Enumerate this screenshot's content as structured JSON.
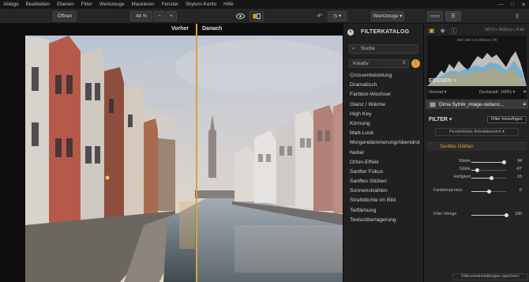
{
  "menu": [
    "Ablage",
    "Bearbeiten",
    "Ebenen",
    "Filter",
    "Werkzeuge",
    "Maskieren",
    "Fenster",
    "Skylum-Konto",
    "Hilfe"
  ],
  "toolbar": {
    "open_label": "Öffnen",
    "zoom_value": "44 %",
    "zoom_out": "−",
    "zoom_in": "+",
    "tools_label": "Werkzeuge"
  },
  "canvas": {
    "before_label": "Vorher",
    "after_label": "Danach"
  },
  "catalog": {
    "title": "FILTERKATALOG",
    "search_placeholder": "Suche",
    "category": "Kreativ",
    "filters": [
      "Crossentwicklung",
      "Dramatisch",
      "Farbton-Wechsel",
      "Glanz / Wärme",
      "High Key",
      "Körnung",
      "Matt-Look",
      "Morgendämmerung/Abendrot",
      "Nebel",
      "Orton-Effekt",
      "Sanfter Fokus",
      "Sanftes Glühen",
      "Sonnenstrahlen",
      "Strahldichte im Bild",
      "Teilfärbung",
      "Texturüberlagerung"
    ]
  },
  "panel": {
    "dimensions": "5870 x 3918 px  |  8-bit",
    "histogram_info": "ISO 100  |  24.00mm  |  f/8",
    "layers_title": "EBENEN",
    "blend_mode": "Normal",
    "opacity_label": "Deckkraft: 100%",
    "layer_name": "Dima Sytnik_image-radianc...",
    "filter_title": "FILTER",
    "add_filter": "Filter hinzufügen",
    "preset_select": "Persönlicher Arbeitsbereich",
    "active_filter": "Sanftes Glühen",
    "sliders": [
      {
        "label": "Stärke",
        "value": "94",
        "level": 0.94
      },
      {
        "label": "Glätte",
        "value": "-67",
        "level": 0.165
      },
      {
        "label": "Helligkeit",
        "value": "15",
        "level": 0.575
      }
    ],
    "color_temp": {
      "label": "Farbtemperatur",
      "value": "0",
      "level": 0.5
    },
    "filter_amount": {
      "label": "Filter Menge",
      "value": "100",
      "level": 1.0
    },
    "save_label": "Filtervoreinstellungen speichern"
  },
  "colors": {
    "accent": "#d8a23a",
    "bg": "#1e1e1e",
    "panel": "#232323"
  }
}
